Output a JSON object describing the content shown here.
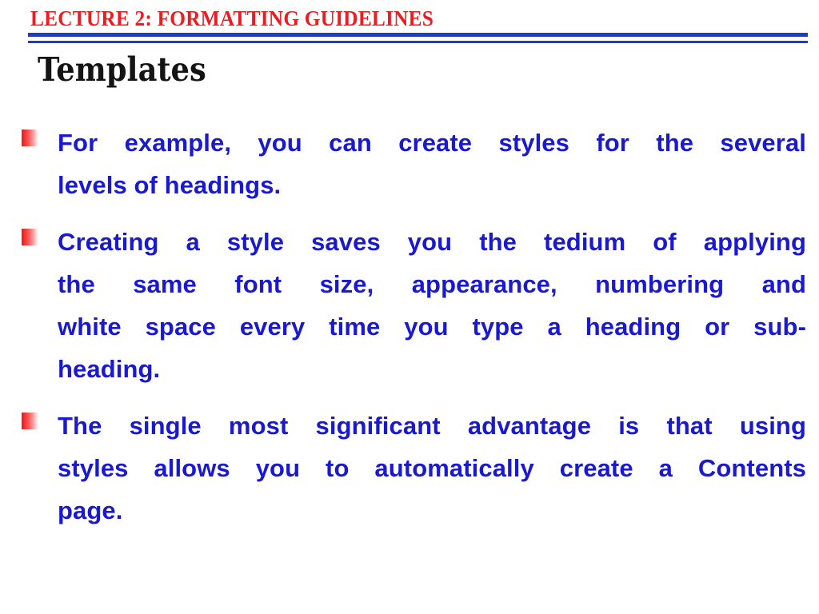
{
  "slide": {
    "header": "LECTURE 2: FORMATTING GUIDELINES",
    "title": "Templates",
    "colors": {
      "header_red": "#ee1c20",
      "rule_blue": "#1b3fc4",
      "title_black": "#141414",
      "body_blue": "#1a19d2",
      "bullet_red": "#f01515",
      "background": "#ffffff"
    },
    "bullets": [
      {
        "marker": "red-gradient-square",
        "text": "For example, you can create styles for the several levels of headings.",
        "lines": [
          "For example, you can create styles for the several",
          "levels of headings."
        ]
      },
      {
        "marker": "red-gradient-square",
        "text": "Creating a style saves you the tedium of applying the same font size, appearance, numbering and white space every time you type a heading or sub-heading.",
        "lines": [
          "Creating a style saves you the tedium of applying",
          "the same font size, appearance, numbering and",
          "white space every time you type a heading or sub-",
          "heading."
        ]
      },
      {
        "marker": "red-gradient-square",
        "text": "The single most significant advantage is that using styles allows you to automatically create a Contents page.",
        "lines": [
          "The single most significant advantage is that using",
          "styles allows you to automatically create a Contents",
          "page."
        ]
      }
    ]
  }
}
